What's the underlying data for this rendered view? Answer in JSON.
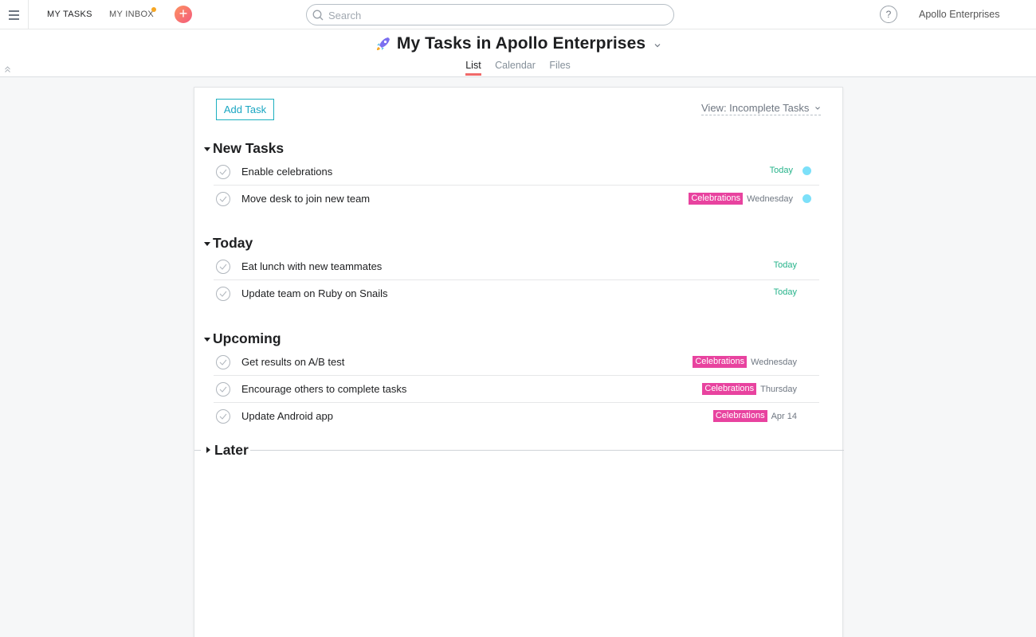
{
  "topbar": {
    "my_tasks": "MY TASKS",
    "my_inbox": "MY INBOX",
    "search_placeholder": "Search",
    "help": "?",
    "org_name": "Apollo Enterprises"
  },
  "header": {
    "title": "My Tasks in Apollo Enterprises",
    "tabs": [
      "List",
      "Calendar",
      "Files"
    ],
    "active_tab": "List"
  },
  "toolbar": {
    "add_task": "Add Task",
    "view_filter": "View: Incomplete Tasks"
  },
  "sections": [
    {
      "title": "New Tasks",
      "tasks": [
        {
          "name": "Enable celebrations",
          "tag": "",
          "due": "Today",
          "dot": true
        },
        {
          "name": "Move desk to join new team",
          "tag": "Celebrations",
          "due": "Wednesday",
          "dot": true
        }
      ]
    },
    {
      "title": "Today",
      "tasks": [
        {
          "name": "Eat lunch with new teammates",
          "tag": "",
          "due": "Today",
          "dot": false
        },
        {
          "name": "Update team on Ruby on Snails",
          "tag": "",
          "due": "Today",
          "dot": false
        }
      ]
    },
    {
      "title": "Upcoming",
      "tasks": [
        {
          "name": "Get results on A/B test",
          "tag": "Celebrations",
          "due": "Wednesday",
          "dot": false
        },
        {
          "name": "Encourage others to complete tasks",
          "tag": "Celebrations",
          "due": "Thursday",
          "dot": false
        },
        {
          "name": "Update Android app",
          "tag": "Celebrations",
          "due": "Apr 14",
          "dot": false
        }
      ]
    },
    {
      "title": "Later",
      "tasks": []
    }
  ],
  "colors": {
    "accent_teal": "#1aa6c2",
    "tag_pink": "#e8439f",
    "today_green": "#25b38a",
    "dot_blue": "#7ce0f9",
    "tab_underline": "#f06a6a"
  }
}
